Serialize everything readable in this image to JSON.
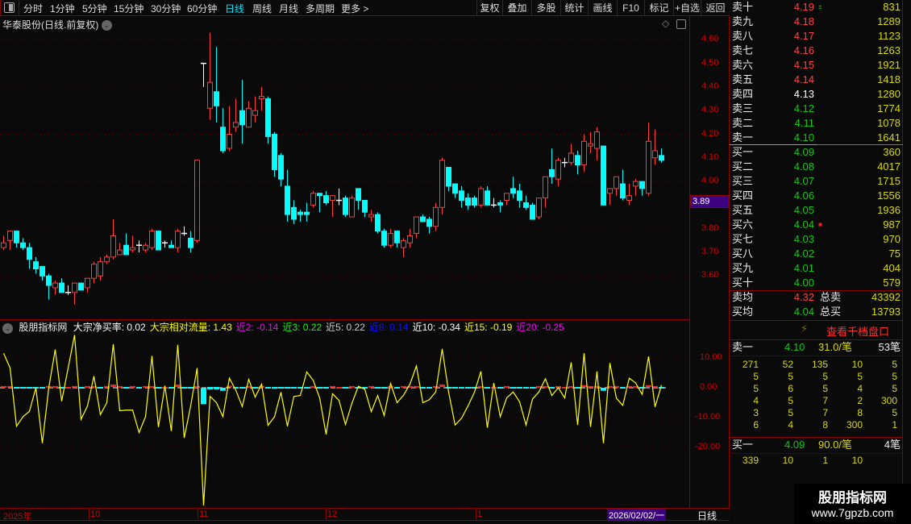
{
  "toolbar": {
    "periods": [
      "分时",
      "1分钟",
      "5分钟",
      "15分钟",
      "30分钟",
      "60分钟",
      "日线",
      "周线",
      "月线",
      "多周期",
      "更多 >"
    ],
    "active_period": "日线",
    "buttons": [
      "复权",
      "叠加",
      "多股",
      "统计",
      "画线",
      "F10",
      "标记",
      "+自选",
      "返回"
    ]
  },
  "chart_title": "华泰股份(日线.前复权)",
  "price_axis": {
    "labels": [
      "4.60",
      "4.50",
      "4.40",
      "4.30",
      "4.20",
      "4.10",
      "4.00",
      "3.80",
      "3.70",
      "3.60"
    ],
    "current_tag": "3.89"
  },
  "indicator": {
    "name": "股朋指标网",
    "items": [
      {
        "text": "大宗净买率: 0.02",
        "color": "#ffffff"
      },
      {
        "text": "大宗相对流量: 1.43",
        "color": "#ffff00"
      },
      {
        "text": "近2: -0.14",
        "color": "#ff00ff"
      },
      {
        "text": "近3: 0.22",
        "color": "#00ff00"
      },
      {
        "text": "近5: 0.22",
        "color": "#cccccc"
      },
      {
        "text": "近8: 0.14",
        "color": "#1010ff"
      },
      {
        "text": "近10: -0.34",
        "color": "#ffffff"
      },
      {
        "text": "近15: -0.19",
        "color": "#ffff00"
      },
      {
        "text": "近20: -0.25",
        "color": "#ff00ff"
      }
    ],
    "axis_labels": [
      "10.00",
      "0.00",
      "-10.00",
      "-20.00"
    ]
  },
  "date_axis": {
    "labels": [
      "2025年",
      "10",
      "11",
      "12",
      "1"
    ],
    "cursor_date": "2026/02/02/一",
    "period": "日线"
  },
  "chart_data": {
    "type": "candlestick",
    "price_range": [
      3.44,
      4.65
    ],
    "colors": {
      "up": "#ff3b3b",
      "down": "#00ffff",
      "flat": "#ffffff"
    },
    "ohlc": [
      [
        3.72,
        3.77,
        3.71,
        3.74
      ],
      [
        3.75,
        3.79,
        3.71,
        3.79
      ],
      [
        3.79,
        3.79,
        3.72,
        3.74
      ],
      [
        3.74,
        3.76,
        3.71,
        3.72
      ],
      [
        3.72,
        3.74,
        3.63,
        3.67
      ],
      [
        3.66,
        3.68,
        3.61,
        3.63
      ],
      [
        3.64,
        3.64,
        3.58,
        3.6
      ],
      [
        3.6,
        3.61,
        3.5,
        3.56
      ],
      [
        3.55,
        3.58,
        3.52,
        3.57
      ],
      [
        3.57,
        3.59,
        3.53,
        3.53
      ],
      [
        3.53,
        3.56,
        3.52,
        3.53
      ],
      [
        3.53,
        3.57,
        3.48,
        3.57
      ],
      [
        3.57,
        3.57,
        3.54,
        3.54
      ],
      [
        3.55,
        3.59,
        3.53,
        3.59
      ],
      [
        3.59,
        3.66,
        3.57,
        3.65
      ],
      [
        3.6,
        3.68,
        3.58,
        3.66
      ],
      [
        3.66,
        3.69,
        3.65,
        3.68
      ],
      [
        3.68,
        3.84,
        3.67,
        3.77
      ],
      [
        3.69,
        3.74,
        3.69,
        3.71
      ],
      [
        3.73,
        3.78,
        3.69,
        3.69
      ],
      [
        3.71,
        3.77,
        3.7,
        3.72
      ],
      [
        3.73,
        3.75,
        3.7,
        3.73
      ],
      [
        3.71,
        3.74,
        3.7,
        3.73
      ],
      [
        3.72,
        3.8,
        3.71,
        3.79
      ],
      [
        3.79,
        3.79,
        3.71,
        3.71
      ],
      [
        3.74,
        3.75,
        3.72,
        3.74
      ],
      [
        3.73,
        3.75,
        3.72,
        3.72
      ],
      [
        3.72,
        3.8,
        3.7,
        3.79
      ],
      [
        3.78,
        3.81,
        3.77,
        3.78
      ],
      [
        3.76,
        3.79,
        3.7,
        3.72
      ],
      [
        3.75,
        4.09,
        3.74,
        4.09
      ],
      [
        4.5,
        4.5,
        4.4,
        4.5
      ],
      [
        4.31,
        4.63,
        4.26,
        4.42
      ],
      [
        4.38,
        4.57,
        4.25,
        4.32
      ],
      [
        4.23,
        4.31,
        4.12,
        4.13
      ],
      [
        4.14,
        4.32,
        4.13,
        4.2
      ],
      [
        4.23,
        4.35,
        4.21,
        4.25
      ],
      [
        4.3,
        4.43,
        4.16,
        4.24
      ],
      [
        4.23,
        4.34,
        4.23,
        4.31
      ],
      [
        4.28,
        4.36,
        4.25,
        4.3
      ],
      [
        4.35,
        4.4,
        4.3,
        4.36
      ],
      [
        4.35,
        4.36,
        4.16,
        4.19
      ],
      [
        4.2,
        4.21,
        4.02,
        4.05
      ],
      [
        4.11,
        4.12,
        3.98,
        4.01
      ],
      [
        3.98,
        4.05,
        3.83,
        3.86
      ],
      [
        3.89,
        3.92,
        3.82,
        3.84
      ],
      [
        3.87,
        3.88,
        3.83,
        3.86
      ],
      [
        3.87,
        3.91,
        3.83,
        3.86
      ],
      [
        3.9,
        3.96,
        3.89,
        3.95
      ],
      [
        3.95,
        3.95,
        3.87,
        3.94
      ],
      [
        3.94,
        3.96,
        3.9,
        3.91
      ],
      [
        3.92,
        3.94,
        3.85,
        3.94
      ],
      [
        3.92,
        3.97,
        3.9,
        3.92
      ],
      [
        3.93,
        3.94,
        3.85,
        3.86
      ],
      [
        3.85,
        3.94,
        3.85,
        3.93
      ],
      [
        3.97,
        3.97,
        3.88,
        3.92
      ],
      [
        3.92,
        3.92,
        3.85,
        3.87
      ],
      [
        3.85,
        3.88,
        3.83,
        3.86
      ],
      [
        3.86,
        3.87,
        3.78,
        3.79
      ],
      [
        3.79,
        3.8,
        3.72,
        3.73
      ],
      [
        3.73,
        3.8,
        3.72,
        3.78
      ],
      [
        3.79,
        3.79,
        3.72,
        3.74
      ],
      [
        3.72,
        3.76,
        3.68,
        3.75
      ],
      [
        3.74,
        3.8,
        3.72,
        3.77
      ],
      [
        3.78,
        3.85,
        3.76,
        3.85
      ],
      [
        3.85,
        3.86,
        3.83,
        3.83
      ],
      [
        3.84,
        3.85,
        3.78,
        3.81
      ],
      [
        3.81,
        3.91,
        3.79,
        3.89
      ],
      [
        3.89,
        4.1,
        3.86,
        4.09
      ],
      [
        4.06,
        4.06,
        3.96,
        3.98
      ],
      [
        3.99,
        3.99,
        3.93,
        3.95
      ],
      [
        3.96,
        3.98,
        3.89,
        3.92
      ],
      [
        3.93,
        3.95,
        3.88,
        3.9
      ],
      [
        3.93,
        3.94,
        3.89,
        3.9
      ],
      [
        3.9,
        3.98,
        3.89,
        3.97
      ],
      [
        3.96,
        3.98,
        3.9,
        3.9
      ],
      [
        3.9,
        3.93,
        3.89,
        3.9
      ],
      [
        3.91,
        3.92,
        3.87,
        3.9
      ],
      [
        3.92,
        3.95,
        3.9,
        3.95
      ],
      [
        3.97,
        4.02,
        3.93,
        3.95
      ],
      [
        3.96,
        3.99,
        3.89,
        3.92
      ],
      [
        3.91,
        3.94,
        3.88,
        3.89
      ],
      [
        3.9,
        3.91,
        3.84,
        3.84
      ],
      [
        3.85,
        3.93,
        3.84,
        3.93
      ],
      [
        3.93,
        4.02,
        3.89,
        4.02
      ],
      [
        4.05,
        4.14,
        3.99,
        4.02
      ],
      [
        4.01,
        4.1,
        3.98,
        4.09
      ],
      [
        4.08,
        4.1,
        4.06,
        4.08
      ],
      [
        4.08,
        4.16,
        4.07,
        4.12
      ],
      [
        4.11,
        4.13,
        4.03,
        4.07
      ],
      [
        4.07,
        4.2,
        4.04,
        4.17
      ],
      [
        4.15,
        4.21,
        4.12,
        4.16
      ],
      [
        4.14,
        4.23,
        4.09,
        4.21
      ],
      [
        4.15,
        4.15,
        3.9,
        3.9
      ],
      [
        3.95,
        3.97,
        3.9,
        3.97
      ],
      [
        3.97,
        4.02,
        3.94,
        4.02
      ],
      [
        3.99,
        4.05,
        3.92,
        3.93
      ],
      [
        3.92,
        3.99,
        3.9,
        3.94
      ],
      [
        3.98,
        4.01,
        3.94,
        4.0
      ],
      [
        4.0,
        4.0,
        3.94,
        3.97
      ],
      [
        3.95,
        4.25,
        3.94,
        4.17
      ],
      [
        4.1,
        4.22,
        4.07,
        4.13
      ],
      [
        4.11,
        4.14,
        4.08,
        4.09
      ]
    ],
    "indicator_range": [
      -42,
      18
    ],
    "relative_flow": [
      11.6,
      6.6,
      -12.9,
      -9.7,
      -7.9,
      0,
      -18.6,
      0,
      12.8,
      -4.5,
      6.6,
      17.7,
      -10.6,
      -6.1,
      3.9,
      -9.0,
      -5.0,
      14.6,
      -7.7,
      -7.5,
      -7.5,
      -15,
      -9.7,
      10.7,
      -13.2,
      0.7,
      -14.5,
      14.4,
      -16.8,
      -6.1,
      6.6,
      -39.5,
      -2.9,
      -5,
      -9.7,
      3.2,
      -0.8,
      -6.3,
      2.8,
      -3.1,
      1.2,
      -12.6,
      -9.7,
      -1.5,
      -12.9,
      -2.9,
      -2.6,
      5.3,
      2.5,
      -3.4,
      -15.6,
      -2,
      -4.2,
      -12.3,
      -5.2,
      0.5,
      -0.5,
      -8,
      -2.6,
      -9.3,
      1.4,
      -5,
      -2.5,
      1.2,
      7.3,
      -5,
      -4,
      -1.4,
      13,
      -1.5,
      -12.5,
      -10.2,
      -6.1,
      -1.5,
      5.5,
      -13.4,
      1.6,
      -9.7,
      -3.4,
      -1.4,
      -4.7,
      -12.5,
      -3.8,
      -1.4,
      3,
      -2.6,
      0,
      -3.4,
      8.5,
      -12.5,
      11.6,
      -13.1,
      5.5,
      -18.6,
      8.3,
      -3.5,
      -5.9,
      3.2,
      1.6,
      -2.2,
      10.5,
      -6.4,
      0.9
    ],
    "net_buy": [
      0.3,
      0.3,
      -0.4,
      -0.4,
      -0.4,
      -0.4,
      -0.4,
      0.3,
      0.3,
      -0.4,
      0,
      0.3,
      -0.4,
      0.3,
      0.3,
      -0.4,
      0.3,
      0.8,
      0.3,
      -0.4,
      0.3,
      -0.4,
      0.3,
      0.3,
      -0.4,
      0,
      -0.4,
      0.8,
      -0.4,
      -0.4,
      0.3,
      -5.5,
      -0.8,
      -0.8,
      -1.0,
      0.4,
      -0.4,
      -0.4,
      0.3,
      -0.4,
      0.3,
      -0.4,
      -0.6,
      -0.3,
      -0.4,
      -0.4,
      -0.4,
      -0.3,
      0.3,
      -0.4,
      -0.3,
      0.3,
      0,
      -0.4,
      0.3,
      -0.4,
      -0.3,
      0.3,
      -0.4,
      -0.4,
      0.3,
      -0.3,
      0.3,
      0.3,
      0.3,
      -0.4,
      -0.4,
      0.3,
      0.8,
      -0.4,
      -0.4,
      -0.4,
      -0.3,
      -0.3,
      0.3,
      -0.4,
      0,
      -0.4,
      0.3,
      -0.3,
      -0.3,
      -0.3,
      -0.4,
      0.3,
      0.3,
      -0.4,
      0.3,
      0,
      0.3,
      -0.4,
      0.6,
      0.3,
      0.3,
      -1.0,
      0.3,
      0.3,
      -0.4,
      0.3,
      0.3,
      -0.4,
      0.6,
      0.3,
      -0.4
    ]
  },
  "order_book": {
    "asks": [
      {
        "label": "卖十",
        "price": "4.19",
        "volume": "831",
        "cls": "up",
        "mark": "±"
      },
      {
        "label": "卖九",
        "price": "4.18",
        "volume": "1289",
        "cls": "up"
      },
      {
        "label": "卖八",
        "price": "4.17",
        "volume": "1123",
        "cls": "up"
      },
      {
        "label": "卖七",
        "price": "4.16",
        "volume": "1263",
        "cls": "up"
      },
      {
        "label": "卖六",
        "price": "4.15",
        "volume": "1921",
        "cls": "up"
      },
      {
        "label": "卖五",
        "price": "4.14",
        "volume": "1418",
        "cls": "up"
      },
      {
        "label": "卖四",
        "price": "4.13",
        "volume": "1280",
        "cls": "eq"
      },
      {
        "label": "卖三",
        "price": "4.12",
        "volume": "1774",
        "cls": "dn"
      },
      {
        "label": "卖二",
        "price": "4.11",
        "volume": "1078",
        "cls": "dn"
      },
      {
        "label": "卖一",
        "price": "4.10",
        "volume": "1641",
        "cls": "dn"
      }
    ],
    "bids": [
      {
        "label": "买一",
        "price": "4.09",
        "volume": "360",
        "cls": "dn"
      },
      {
        "label": "买二",
        "price": "4.08",
        "volume": "4017",
        "cls": "dn"
      },
      {
        "label": "买三",
        "price": "4.07",
        "volume": "1715",
        "cls": "dn"
      },
      {
        "label": "买四",
        "price": "4.06",
        "volume": "1556",
        "cls": "dn"
      },
      {
        "label": "买五",
        "price": "4.05",
        "volume": "1936",
        "cls": "dn"
      },
      {
        "label": "买六",
        "price": "4.04",
        "volume": "987",
        "cls": "dn",
        "mark": "■"
      },
      {
        "label": "买七",
        "price": "4.03",
        "volume": "970",
        "cls": "dn"
      },
      {
        "label": "买八",
        "price": "4.02",
        "volume": "75",
        "cls": "dn"
      },
      {
        "label": "买九",
        "price": "4.01",
        "volume": "404",
        "cls": "dn"
      },
      {
        "label": "买十",
        "price": "4.00",
        "volume": "579",
        "cls": "dn"
      }
    ],
    "avg_sell": {
      "label": "卖均",
      "price": "4.32",
      "total_label": "总卖",
      "total": "43392"
    },
    "avg_buy": {
      "label": "买均",
      "price": "4.04",
      "total_label": "总买",
      "total": "13793"
    },
    "depth_link": "查看千档盘口",
    "ask1_detail": {
      "label": "卖一",
      "price": "4.10",
      "avg": "31.0/笔",
      "count": "53笔",
      "orders": [
        [
          "271",
          "52",
          "135",
          "10",
          "5"
        ],
        [
          "5",
          "5",
          "5",
          "5",
          "5"
        ],
        [
          "5",
          "6",
          "5",
          "4",
          "5"
        ],
        [
          "4",
          "5",
          "7",
          "2",
          "300"
        ],
        [
          "3",
          "5",
          "7",
          "8",
          "5"
        ],
        [
          "6",
          "4",
          "8",
          "300",
          "1"
        ]
      ]
    },
    "bid1_detail": {
      "label": "买一",
      "price": "4.09",
      "avg": "90.0/笔",
      "count": "4笔",
      "orders": [
        [
          "339",
          "10",
          "1",
          "10"
        ]
      ]
    }
  },
  "watermark": {
    "name": "股朋指标网",
    "url": "www.7gpzb.com"
  }
}
